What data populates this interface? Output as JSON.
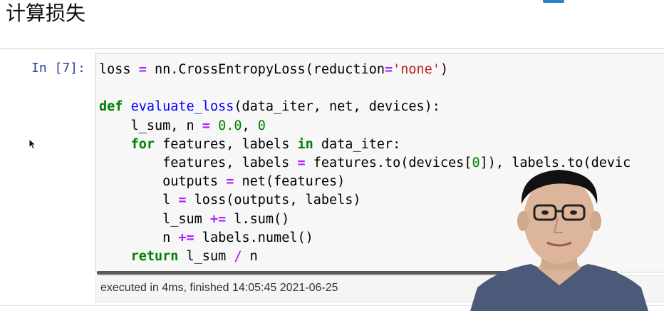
{
  "page": {
    "heading": "计算损失"
  },
  "cell": {
    "prompt": "In [7]:",
    "code_lines": [
      "loss = nn.CrossEntropyLoss(reduction='none')",
      "",
      "def evaluate_loss(data_iter, net, devices):",
      "    l_sum, n = 0.0, 0",
      "    for features, labels in data_iter:",
      "        features, labels = features.to(devices[0]), labels.to(devic",
      "        outputs = net(features)",
      "        l = loss(outputs, labels)",
      "        l_sum += l.sum()",
      "        n += labels.numel()",
      "    return l_sum / n"
    ],
    "execution_status": "executed in 4ms, finished 14:05:45 2021-06-25"
  },
  "colors": {
    "keyword": "#008000",
    "function_name": "#0000ff",
    "operator": "#aa22ff",
    "string": "#ba2121",
    "prompt": "#303f9f"
  },
  "icons": [
    "mouse-cursor-icon"
  ]
}
